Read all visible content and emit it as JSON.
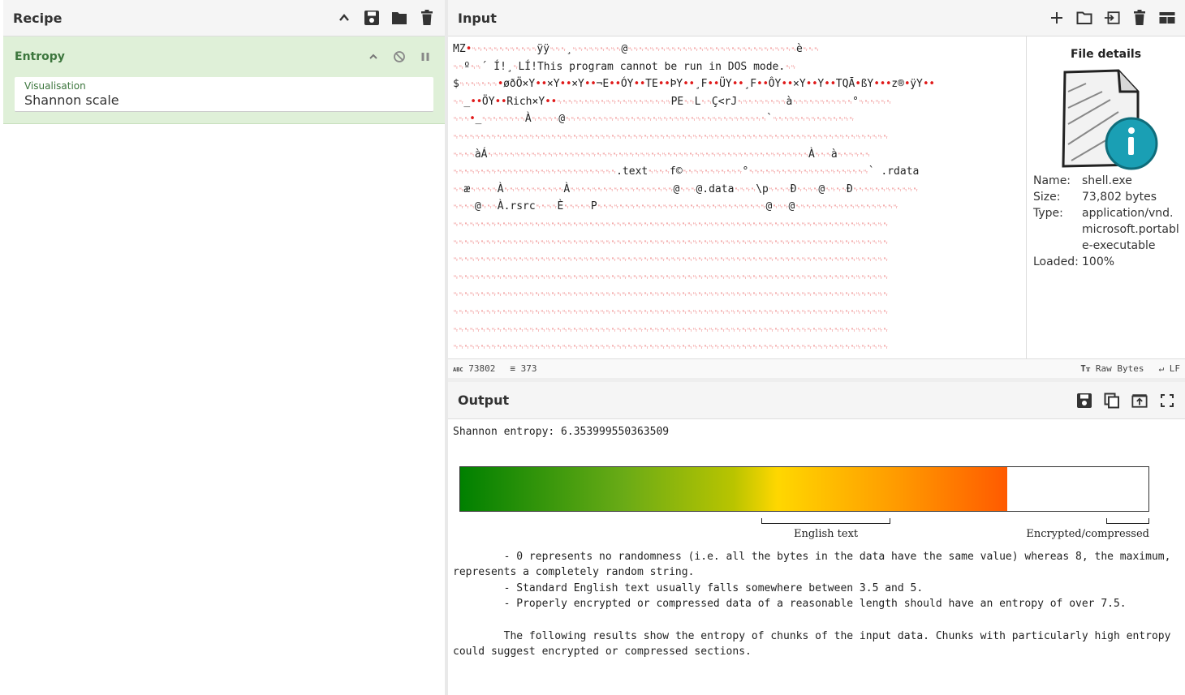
{
  "recipe": {
    "title": "Recipe",
    "operation": {
      "name": "Entropy",
      "arg_label": "Visualisation",
      "arg_value": "Shannon scale"
    }
  },
  "input": {
    "title": "Input",
    "lines": [
      "MZ•␉␉␉␉␉␉␉␉␉␉␉␉ÿÿ␉␉␉¸␉␉␉␉␉␉␉␉␉@␉␉␉␉␉␉␉␉␉␉␉␉␉␉␉␉␉␉␉␉␉␉␉␉␉␉␉␉␉␉␉è␉␉␉",
      "␉␉º␉␉´ Í!¸␉LÍ!This program cannot be run in DOS mode.␉␉",
      "$␉␉␉␉␉␉␉•øðÖ×Y••×Y••×Y••¬E••ÓY••TE••ÞY••¸F••ÜY••¸F••ÔY••×Y••Y••TQĀ•ßY•••z®•ÿY••",
      "␉␉_••ÖY••Rich×Y••␉␉␉␉␉␉␉␉␉␉␉␉␉␉␉␉␉␉␉␉␉PE␉␉L␉␉Ç<rJ␉␉␉␉␉␉␉␉␉à␉␉␉␉␉␉␉␉␉␉␉°␉␉␉␉␉␉",
      "␉␉␉•_␉␉␉␉␉␉␉␉À␉␉␉␉␉@␉␉␉␉␉␉␉␉␉␉␉␉␉␉␉␉␉␉␉␉␉␉␉␉␉␉␉␉␉␉␉␉␉␉␉␉␉`␉␉␉␉␉␉␉␉␉␉␉␉␉␉␉",
      "␉␉␉␉␉␉␉␉␉␉␉␉␉␉␉␉␉␉␉␉␉␉␉␉␉␉␉␉␉␉␉␉␉␉␉␉␉␉␉␉␉␉␉␉␉␉␉␉␉␉␉␉␉␉␉␉␉␉␉␉␉␉␉␉␉␉␉␉␉␉␉␉␉␉␉␉␉␉␉␉",
      "␉␉␉␉àÁ␉␉␉␉␉␉␉␉␉␉␉␉␉␉␉␉␉␉␉␉␉␉␉␉␉␉␉␉␉␉␉␉␉␉␉␉␉␉␉␉␉␉␉␉␉␉␉␉␉␉␉␉␉␉␉␉␉␉␉À␉␉␉à␉␉␉␉␉␉",
      "␉␉␉␉␉␉␉␉␉␉␉␉␉␉␉␉␉␉␉␉␉␉␉␉␉␉␉␉␉␉.text␉␉␉␉f©␉␉␉␉␉␉␉␉␉␉␉°␉␉␉␉␉␉␉␉␉␉␉␉␉␉␉␉␉␉␉␉␉␉` .rdata",
      "␉␉æ␉␉␉␉␉À␉␉␉␉␉␉␉␉␉␉␉À␉␉␉␉␉␉␉␉␉␉␉␉␉␉␉␉␉␉␉@␉␉␉@.data␉␉␉␉\\p␉␉␉␉Ð␉␉␉␉@␉␉␉␉Ð␉␉␉␉␉␉␉␉␉␉␉␉",
      "␉␉␉␉@␉␉␉À.rsrc␉␉␉␉È␉␉␉␉␉P␉␉␉␉␉␉␉␉␉␉␉␉␉␉␉␉␉␉␉␉␉␉␉␉␉␉␉␉␉␉␉@␉␉␉@␉␉␉␉␉␉␉␉␉␉␉␉␉␉␉␉␉␉␉",
      "␉␉␉␉␉␉␉␉␉␉␉␉␉␉␉␉␉␉␉␉␉␉␉␉␉␉␉␉␉␉␉␉␉␉␉␉␉␉␉␉␉␉␉␉␉␉␉␉␉␉␉␉␉␉␉␉␉␉␉␉␉␉␉␉␉␉␉␉␉␉␉␉␉␉␉␉␉␉␉␉",
      "␉␉␉␉␉␉␉␉␉␉␉␉␉␉␉␉␉␉␉␉␉␉␉␉␉␉␉␉␉␉␉␉␉␉␉␉␉␉␉␉␉␉␉␉␉␉␉␉␉␉␉␉␉␉␉␉␉␉␉␉␉␉␉␉␉␉␉␉␉␉␉␉␉␉␉␉␉␉␉␉",
      "␉␉␉␉␉␉␉␉␉␉␉␉␉␉␉␉␉␉␉␉␉␉␉␉␉␉␉␉␉␉␉␉␉␉␉␉␉␉␉␉␉␉␉␉␉␉␉␉␉␉␉␉␉␉␉␉␉␉␉␉␉␉␉␉␉␉␉␉␉␉␉␉␉␉␉␉␉␉␉␉",
      "␉␉␉␉␉␉␉␉␉␉␉␉␉␉␉␉␉␉␉␉␉␉␉␉␉␉␉␉␉␉␉␉␉␉␉␉␉␉␉␉␉␉␉␉␉␉␉␉␉␉␉␉␉␉␉␉␉␉␉␉␉␉␉␉␉␉␉␉␉␉␉␉␉␉␉␉␉␉␉␉",
      "␉␉␉␉␉␉␉␉␉␉␉␉␉␉␉␉␉␉␉␉␉␉␉␉␉␉␉␉␉␉␉␉␉␉␉␉␉␉␉␉␉␉␉␉␉␉␉␉␉␉␉␉␉␉␉␉␉␉␉␉␉␉␉␉␉␉␉␉␉␉␉␉␉␉␉␉␉␉␉␉",
      "␉␉␉␉␉␉␉␉␉␉␉␉␉␉␉␉␉␉␉␉␉␉␉␉␉␉␉␉␉␉␉␉␉␉␉␉␉␉␉␉␉␉␉␉␉␉␉␉␉␉␉␉␉␉␉␉␉␉␉␉␉␉␉␉␉␉␉␉␉␉␉␉␉␉␉␉␉␉␉␉",
      "␉␉␉␉␉␉␉␉␉␉␉␉␉␉␉␉␉␉␉␉␉␉␉␉␉␉␉␉␉␉␉␉␉␉␉␉␉␉␉␉␉␉␉␉␉␉␉␉␉␉␉␉␉␉␉␉␉␉␉␉␉␉␉␉␉␉␉␉␉␉␉␉␉␉␉␉␉␉␉␉",
      "␉␉␉␉␉␉␉␉␉␉␉␉␉␉␉␉␉␉␉␉␉␉␉␉␉␉␉␉␉␉␉␉␉␉␉␉␉␉␉␉␉␉␉␉␉␉␉␉␉␉␉␉␉␉␉␉␉␉␉␉␉␉␉␉␉␉␉␉␉␉␉␉␉␉␉␉␉␉␉␉",
      "␉␉␉␉␉␉␉␉␉␉␉␉␉␉␉␉␉␉␉␉␉␉␉␉␉␉␉␉␉␉␉␉␉␉␉␉␉␉␉␉␉␉␉␉␉␉␉␉␉␉␉␉␉␉␉␉␉␉␉␉␉␉␉␉␉␉␉␉␉␉␉␉␉␉␉␉␉␉␉␉",
      "␉␉␉␉␉␉␉␉␉␉␉␉␉␉␉␉␉␉␉␉␉␉␉␉␉␉␉␉␉␉␉␉␉␉␉␉␉␉␉␉␉␉␉␉␉␉␉␉␉␉␉␉␉␉␉␉␉␉␉␉␉␉␉␉␉␉␉␉␉␉␉␉␉␉␉␉␉␉␉␉"
    ],
    "file_details": {
      "title": "File details",
      "name_label": "Name:",
      "name": "shell.exe",
      "size_label": "Size:",
      "size": "73,802 bytes",
      "type_label": "Type:",
      "type": "application/vnd.microsoft.portable-executable",
      "loaded_label": "Loaded:",
      "loaded": "100%"
    },
    "status": {
      "length": "73802",
      "lines": "373",
      "encoding": "Raw Bytes",
      "eol": "LF"
    }
  },
  "output": {
    "title": "Output",
    "entropy_line": "Shannon entropy: 6.353999550363509",
    "entropy_value": 6.353999550363509,
    "scale_max": 8,
    "fill_color_end": "#ff5a00",
    "brackets": [
      {
        "label": "English text",
        "from": 3.5,
        "to": 5
      },
      {
        "label": "Encrypted/compressed",
        "from": 7.5,
        "to": 8
      }
    ],
    "description": "        - 0 represents no randomness (i.e. all the bytes in the data have the same value) whereas 8, the maximum, represents a completely random string.\n        - Standard English text usually falls somewhere between 3.5 and 5.\n        - Properly encrypted or compressed data of a reasonable length should have an entropy of over 7.5.\n\n        The following results show the entropy of chunks of the input data. Chunks with particularly high entropy could suggest encrypted or compressed sections."
  },
  "icons": {
    "recipe_toolbar": [
      "chevron-up-icon",
      "save-icon",
      "folder-icon",
      "trash-icon"
    ],
    "op_controls": [
      "chevron-up-icon",
      "disable-icon",
      "pause-icon"
    ],
    "input_toolbar": [
      "plus-icon",
      "folder-icon",
      "import-icon",
      "trash-icon",
      "layout-icon"
    ],
    "output_toolbar": [
      "save-icon",
      "copy-icon",
      "replace-input-icon",
      "maximise-icon"
    ]
  }
}
